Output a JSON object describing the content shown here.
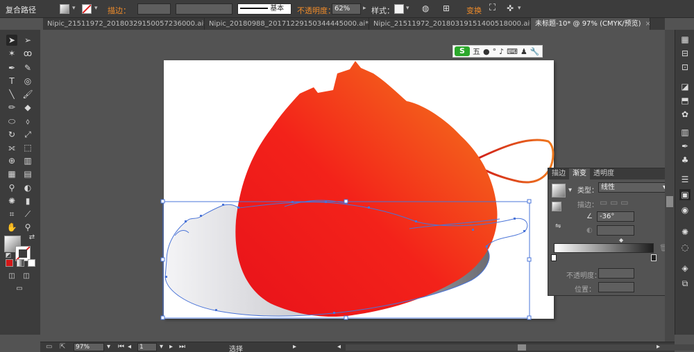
{
  "control_bar": {
    "object_type": "复合路径",
    "stroke_label": "描边：",
    "stroke_profile": "基本",
    "opacity_label": "不透明度：",
    "opacity_value": "62%",
    "style_label": "样式：",
    "transform_label": "变换"
  },
  "tabs": [
    {
      "label": "Nipic_21511972_20180329150057236000.ai*…",
      "close": "×",
      "active": false
    },
    {
      "label": "Nipic_20180988_20171229150344445000.ai*…",
      "close": "×",
      "active": false
    },
    {
      "label": "Nipic_21511972_20180319151400518000.ai*…",
      "close": "×",
      "active": false
    },
    {
      "label": "未标题-10* @ 97% (CMYK/预览)",
      "close": "×",
      "active": true
    }
  ],
  "ime_bar": {
    "logo": "S",
    "mode": "五"
  },
  "gradient_panel": {
    "tabs": [
      "描边",
      "渐变",
      "透明度"
    ],
    "active_tab": "渐变",
    "type_label": "类型：",
    "type_value": "线性",
    "stroke_label": "描边：",
    "angle_value": "-36°",
    "opacity_label": "不透明度：",
    "location_label": "位置："
  },
  "status_bar": {
    "zoom": "97%",
    "artboard_index": "1",
    "tool_name": "选择"
  },
  "colors": {
    "accent_orange": "#f08c2a",
    "shape_red": "#ee1d17",
    "shape_orange": "#f26f1e",
    "selection_blue": "#4a74d8"
  }
}
